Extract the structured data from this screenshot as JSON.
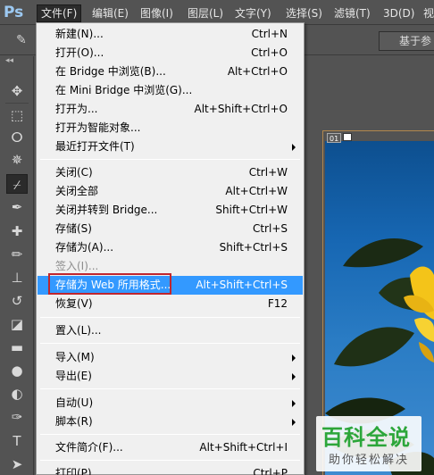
{
  "app": {
    "logo": "Ps"
  },
  "menubar": {
    "items": [
      {
        "label": "文件(F)",
        "active": true
      },
      {
        "label": "编辑(E)"
      },
      {
        "label": "图像(I)"
      },
      {
        "label": "图层(L)"
      },
      {
        "label": "文字(Y)"
      },
      {
        "label": "选择(S)"
      },
      {
        "label": "滤镜(T)"
      },
      {
        "label": "3D(D)"
      },
      {
        "label": "视"
      }
    ]
  },
  "optionsbar": {
    "button_label": "基于参"
  },
  "canvas": {
    "slice_badge": "01"
  },
  "file_menu": {
    "items": [
      {
        "label": "新建(N)...",
        "shortcut": "Ctrl+N"
      },
      {
        "label": "打开(O)...",
        "shortcut": "Ctrl+O"
      },
      {
        "label": "在 Bridge 中浏览(B)...",
        "shortcut": "Alt+Ctrl+O"
      },
      {
        "label": "在 Mini Bridge 中浏览(G)...",
        "shortcut": ""
      },
      {
        "label": "打开为...",
        "shortcut": "Alt+Shift+Ctrl+O"
      },
      {
        "label": "打开为智能对象...",
        "shortcut": ""
      },
      {
        "label": "最近打开文件(T)",
        "shortcut": "",
        "submenu": true
      },
      {
        "label": "关闭(C)",
        "shortcut": "Ctrl+W"
      },
      {
        "label": "关闭全部",
        "shortcut": "Alt+Ctrl+W"
      },
      {
        "label": "关闭并转到 Bridge...",
        "shortcut": "Shift+Ctrl+W"
      },
      {
        "label": "存储(S)",
        "shortcut": "Ctrl+S"
      },
      {
        "label": "存储为(A)...",
        "shortcut": "Shift+Ctrl+S"
      },
      {
        "label": "签入(I)...",
        "shortcut": "",
        "disabled": true
      },
      {
        "label": "存储为 Web 所用格式...",
        "shortcut": "Alt+Shift+Ctrl+S",
        "highlighted": true
      },
      {
        "label": "恢复(V)",
        "shortcut": "F12"
      },
      {
        "label": "置入(L)...",
        "shortcut": ""
      },
      {
        "label": "导入(M)",
        "shortcut": "",
        "submenu": true
      },
      {
        "label": "导出(E)",
        "shortcut": "",
        "submenu": true
      },
      {
        "label": "自动(U)",
        "shortcut": "",
        "submenu": true
      },
      {
        "label": "脚本(R)",
        "shortcut": "",
        "submenu": true
      },
      {
        "label": "文件简介(F)...",
        "shortcut": "Alt+Shift+Ctrl+I"
      },
      {
        "label": "打印(P)...",
        "shortcut": "Ctrl+P"
      }
    ]
  },
  "watermark": {
    "title": "百科全说",
    "subtitle": "助你轻松解决"
  },
  "colors": {
    "highlight": "#3399ff",
    "redbox": "#c0262e",
    "menu_bg": "#f0f0f0",
    "ui_bg": "#535353"
  },
  "icons": {
    "tools": [
      "move-icon",
      "marquee-icon",
      "lasso-icon",
      "magic-wand-icon",
      "crop-icon",
      "eyedropper-icon",
      "healing-icon",
      "brush-icon",
      "stamp-icon",
      "history-brush-icon",
      "eraser-icon",
      "gradient-icon",
      "blur-icon",
      "dodge-icon",
      "pen-icon",
      "type-icon",
      "path-select-icon"
    ]
  }
}
